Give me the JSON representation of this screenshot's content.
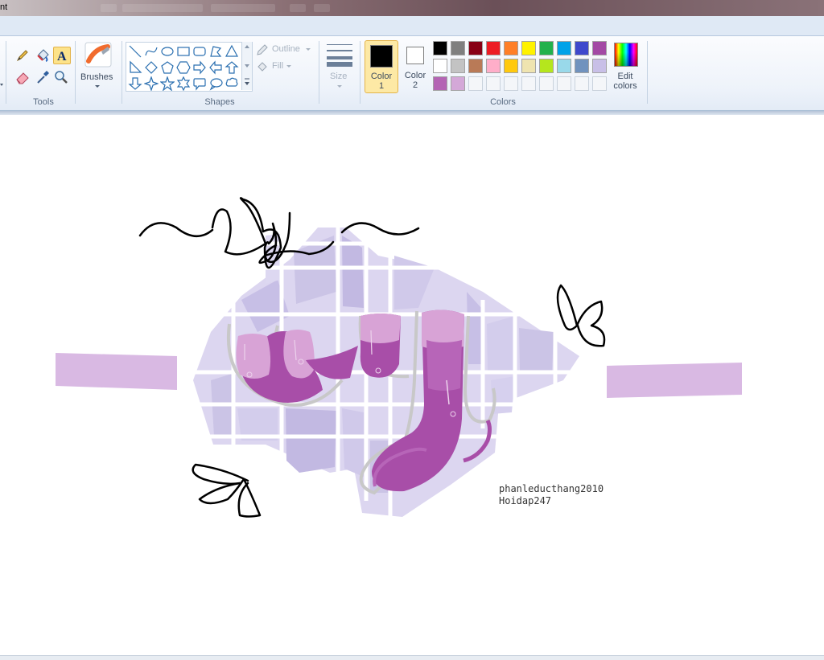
{
  "window": {
    "title_fragment": "nt"
  },
  "ribbon": {
    "groups": {
      "tools": "Tools",
      "shapes": "Shapes",
      "colors": "Colors"
    },
    "tools": [
      {
        "name": "pencil-icon"
      },
      {
        "name": "fill-bucket-icon"
      },
      {
        "name": "text-icon",
        "glyph": "A"
      },
      {
        "name": "eraser-icon"
      },
      {
        "name": "color-picker-icon"
      },
      {
        "name": "magnifier-icon"
      }
    ],
    "brushes_label": "Brushes",
    "outline_label": "Outline",
    "fill_label": "Fill",
    "size_label": "Size",
    "color1_label_line1": "Color",
    "color1_label_line2": "1",
    "color2_label_line1": "Color",
    "color2_label_line2": "2",
    "edit_colors_line1": "Edit",
    "edit_colors_line2": "colors",
    "color1": "#000000",
    "color2": "#ffffff",
    "palette_row1": [
      "#000000",
      "#7f7f7f",
      "#880015",
      "#ed1c24",
      "#ff7f27",
      "#fff200",
      "#22b14c",
      "#00a2e8",
      "#3f48cc",
      "#a349a4"
    ],
    "palette_row2": [
      "#ffffff",
      "#c3c3c3",
      "#b97a57",
      "#ffaec9",
      "#ffc90e",
      "#efe4b0",
      "#b5e61d",
      "#99d9ea",
      "#7092be",
      "#c8bfe7"
    ],
    "palette_row3": [
      "#b464b4",
      "#d4a8d8",
      "",
      "",
      "",
      "",
      "",
      "",
      "",
      ""
    ]
  },
  "canvas": {
    "signature_line1": "phanleducthang2010",
    "signature_line2": "Hoidap247",
    "accent_purple": "#a84ea8",
    "light_purple": "#d9b9e3",
    "tile_lavender": "#cbc4e6"
  }
}
